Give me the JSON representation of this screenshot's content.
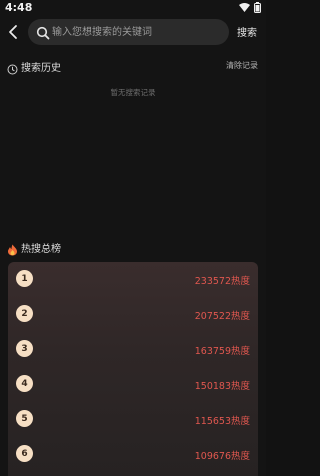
{
  "status_bar": {
    "time": "4:48",
    "icons": [
      "wifi-icon",
      "battery-icon"
    ]
  },
  "search": {
    "placeholder": "输入您想搜索的关键词",
    "button_label": "搜索",
    "back_icon": "back-arrow-icon",
    "search_icon": "search-icon"
  },
  "history": {
    "icon": "clock-icon",
    "title": "搜索历史",
    "clear_label": "清除记录",
    "empty_text": "暂无搜索记录"
  },
  "hot": {
    "icon": "fire-icon",
    "title": "热搜总榜",
    "items": [
      {
        "rank": "1",
        "heat": "233572热度"
      },
      {
        "rank": "2",
        "heat": "207522热度"
      },
      {
        "rank": "3",
        "heat": "163759热度"
      },
      {
        "rank": "4",
        "heat": "150183热度"
      },
      {
        "rank": "5",
        "heat": "115653热度"
      },
      {
        "rank": "6",
        "heat": "109676热度"
      }
    ]
  },
  "colors": {
    "background": "#141414",
    "heat_text": "#e0574f",
    "rank_badge": "#f6dfc4",
    "search_box": "#2b2b2b"
  }
}
